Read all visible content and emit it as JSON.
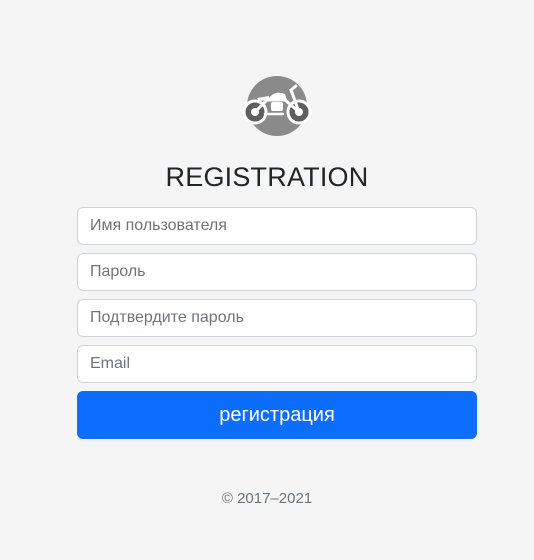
{
  "logo": {
    "icon": "motorcycle-icon",
    "circle_color": "#8a8a8a"
  },
  "form": {
    "title": "REGISTRATION",
    "username_placeholder": "Имя пользователя",
    "password_placeholder": "Пароль",
    "confirm_password_placeholder": "Подтвердите пароль",
    "email_placeholder": "Email",
    "submit_label": "регистрация"
  },
  "footer": {
    "copyright": "© 2017–2021"
  },
  "colors": {
    "background": "#f5f5f5",
    "primary": "#0d6efd",
    "border": "#ced4da",
    "placeholder": "#6c757d"
  }
}
